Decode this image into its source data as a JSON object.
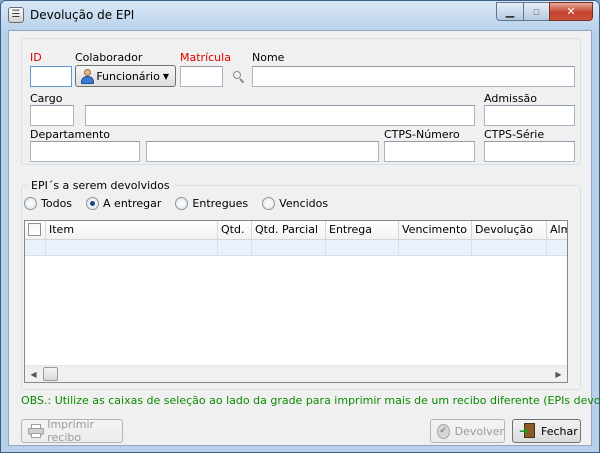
{
  "window": {
    "title": "Devolução de EPI"
  },
  "form": {
    "id_label": "ID",
    "colaborador_label": "Colaborador",
    "colaborador_value": "Funcionário",
    "matricula_label": "Matrícula",
    "nome_label": "Nome",
    "cargo_label": "Cargo",
    "admissao_label": "Admissão",
    "departamento_label": "Departamento",
    "ctps_numero_label": "CTPS-Número",
    "ctps_serie_label": "CTPS-Série",
    "id_value": "",
    "matricula_value": "",
    "nome_value": "",
    "cargo_code_value": "",
    "cargo_name_value": "",
    "admissao_value": "",
    "departamento_code_value": "",
    "departamento_name_value": "",
    "ctps_numero_value": "",
    "ctps_serie_value": ""
  },
  "epis": {
    "group_label": "EPI´s a serem devolvidos",
    "filters": [
      {
        "label": "Todos",
        "selected": false
      },
      {
        "label": "A entregar",
        "selected": true
      },
      {
        "label": "Entregues",
        "selected": false
      },
      {
        "label": "Vencidos",
        "selected": false
      }
    ],
    "columns": [
      "Item",
      "Qtd.",
      "Qtd. Parcial",
      "Entrega",
      "Vencimento",
      "Devolução",
      "Alm"
    ]
  },
  "obs_text": "OBS.: Utilize as caixas de seleção ao lado da grade para imprimir mais de um recibo diferente (EPIs devolvidos).",
  "buttons": {
    "imprimir": "Imprimir recibo",
    "devolver": "Devolver",
    "fechar": "Fechar"
  },
  "icons": {
    "app": "app-icon",
    "colaborador": "person-icon",
    "search": "search-icon",
    "print": "printer-icon",
    "devolver": "check-icon",
    "fechar": "exit-icon"
  },
  "colors": {
    "required_label": "#e00000",
    "obs_text": "#0a8a00",
    "titlebar": "#bcd3ec"
  }
}
